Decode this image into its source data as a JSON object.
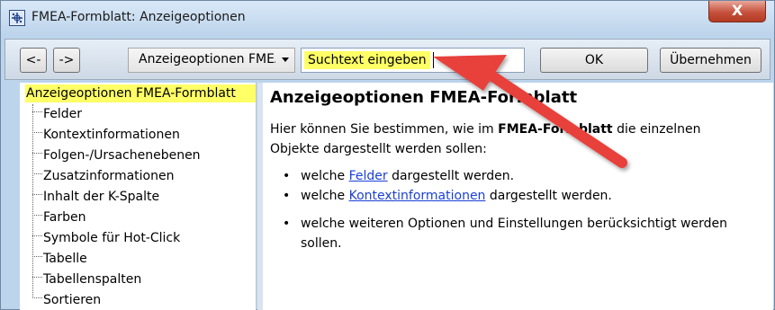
{
  "window": {
    "title": "FMEA-Formblatt: Anzeigeoptionen",
    "close_label": "X"
  },
  "toolbar": {
    "back_label": "<-",
    "forward_label": "->",
    "dropdown_value": "Anzeigeoptionen FMEA-Formblatt",
    "search_value": "Suchtext eingeben",
    "ok_label": "OK",
    "apply_label": "Übernehmen"
  },
  "tree": {
    "root": "Anzeigeoptionen FMEA-Formblatt",
    "items": [
      "Felder",
      "Kontextinformationen",
      "Folgen-/Ursachenebenen",
      "Zusatzinformationen",
      "Inhalt der K-Spalte",
      "Farben",
      "Symbole für Hot-Click",
      "Tabelle",
      "Tabellenspalten",
      "Sortieren"
    ]
  },
  "content": {
    "title": "Anzeigeoptionen FMEA-Formblatt",
    "intro_part1": "Hier können Sie bestimmen, wie im ",
    "intro_bold": "FMEA-Formblatt",
    "intro_part2": " die einzelnen",
    "intro_line2": "Objekte dargestellt werden sollen:",
    "bullets": [
      {
        "prefix": "welche ",
        "link": "Felder",
        "suffix": " dargestellt werden."
      },
      {
        "prefix": "welche ",
        "link": "Kontextinformationen",
        "suffix": " dargestellt werden."
      },
      {
        "line1": "welche weiteren Optionen und Einstellungen berücksichtigt werden",
        "line2": "sollen."
      }
    ]
  },
  "colors": {
    "highlight": "#ffff66",
    "link": "#1a3fd8",
    "arrow": "#e8403a"
  }
}
